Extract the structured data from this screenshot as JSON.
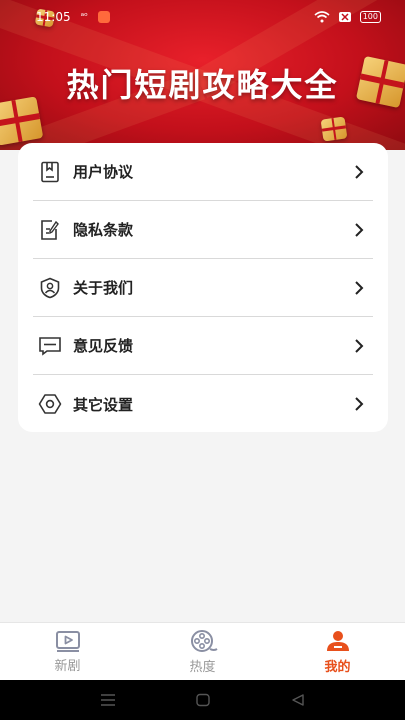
{
  "status_bar": {
    "time": "11:05",
    "battery": "100"
  },
  "banner": {
    "title": "热门短剧攻略大全"
  },
  "menu": {
    "items": [
      {
        "label": "用户协议",
        "icon": "document-icon"
      },
      {
        "label": "隐私条款",
        "icon": "edit-document-icon"
      },
      {
        "label": "关于我们",
        "icon": "shield-user-icon"
      },
      {
        "label": "意见反馈",
        "icon": "message-icon"
      },
      {
        "label": "其它设置",
        "icon": "gear-icon"
      }
    ]
  },
  "tabbar": {
    "tabs": [
      {
        "label": "新剧",
        "icon": "video-play-icon",
        "active": false
      },
      {
        "label": "热度",
        "icon": "film-reel-icon",
        "active": false
      },
      {
        "label": "我的",
        "icon": "user-profile-icon",
        "active": true
      }
    ]
  },
  "colors": {
    "accent": "#e8501c",
    "banner": "#c3101b"
  }
}
